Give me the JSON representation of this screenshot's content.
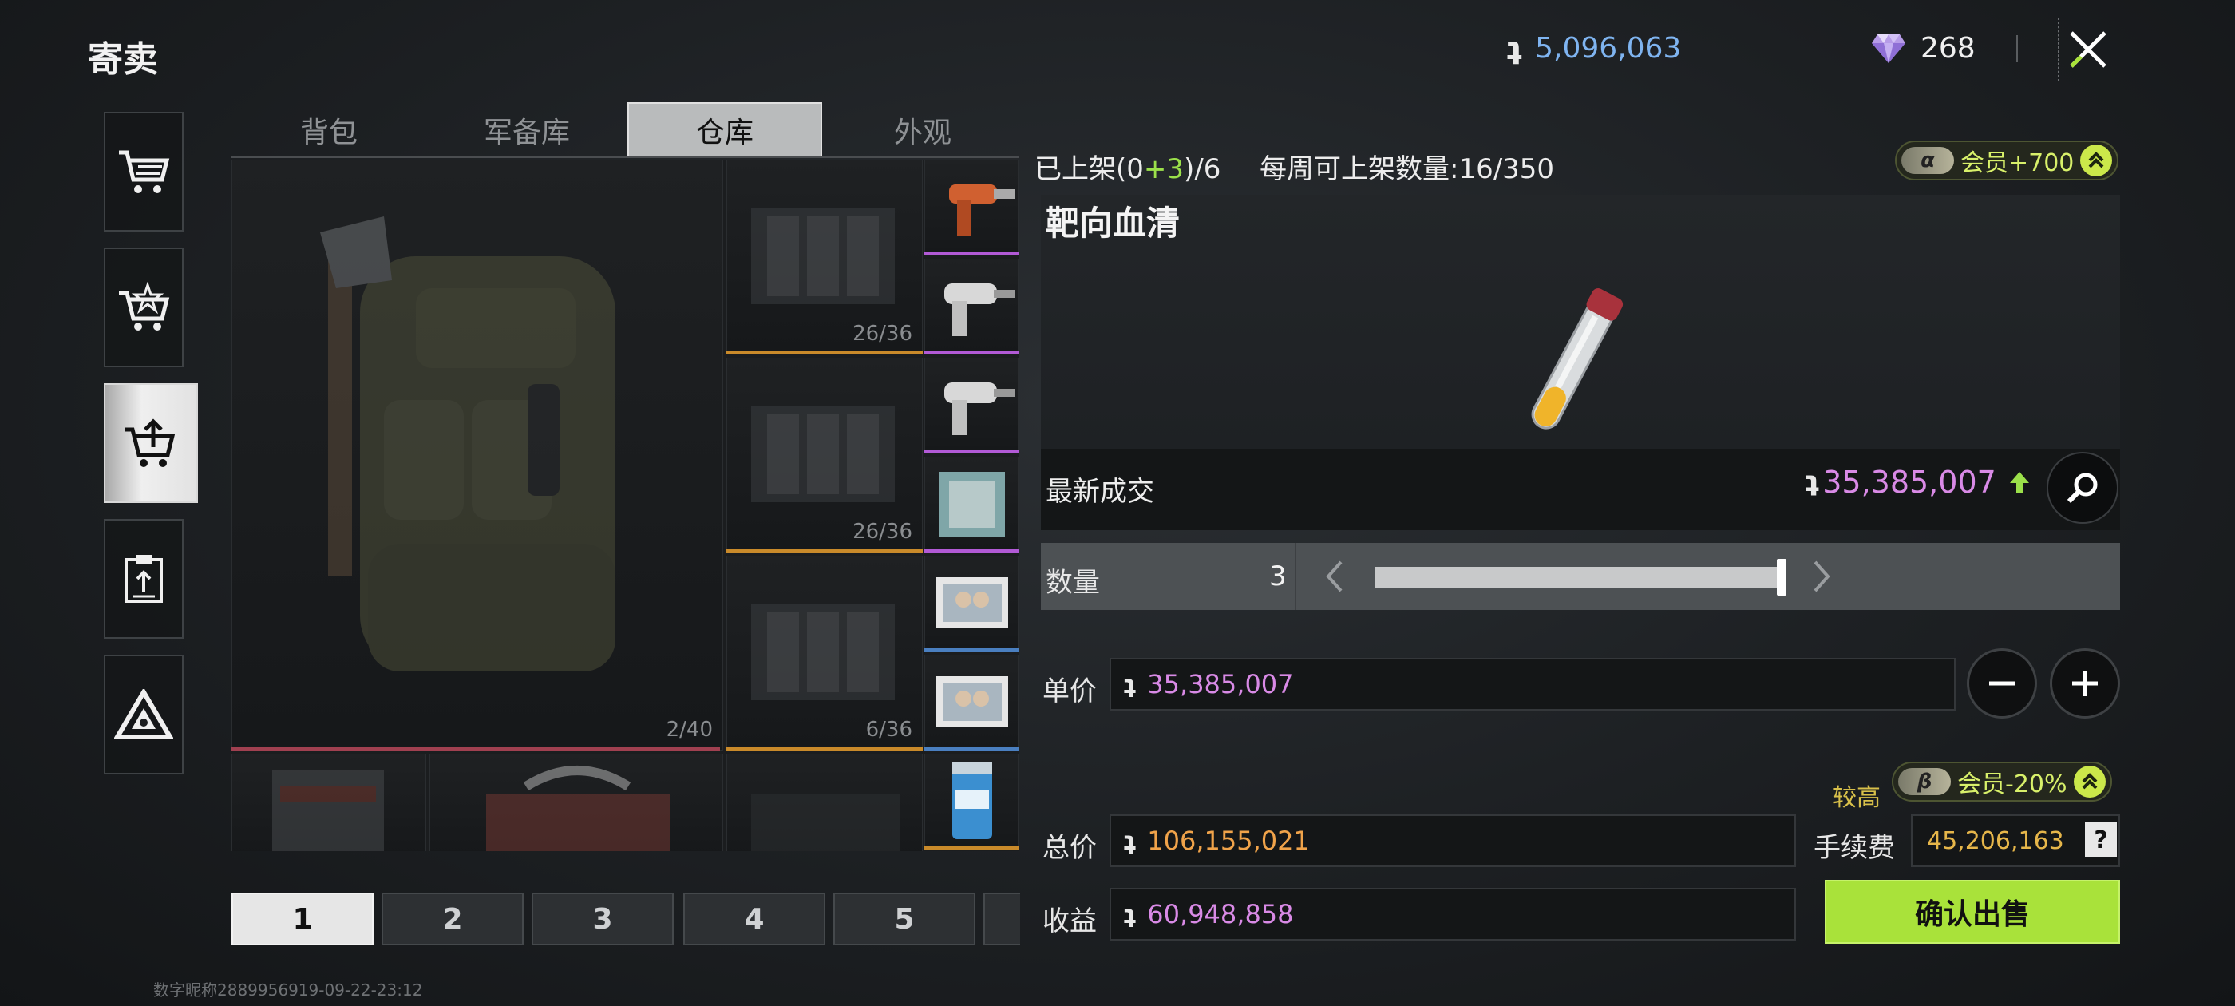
{
  "header": {
    "title": "寄卖",
    "currency_icon": "coin-icon",
    "currency_amount": "5,096,063",
    "gem_icon": "diamond-icon",
    "gem_amount": "268",
    "close_icon": "close-icon"
  },
  "sidebar": {
    "items": [
      {
        "name": "market-buy",
        "icon": "cart-icon"
      },
      {
        "name": "market-bid",
        "icon": "cart-star-icon"
      },
      {
        "name": "market-sell",
        "icon": "cart-upload-icon",
        "active": true
      },
      {
        "name": "records",
        "icon": "clipboard-icon"
      },
      {
        "name": "delta",
        "icon": "triangle-icon"
      }
    ]
  },
  "tabs": [
    "背包",
    "军备库",
    "仓库",
    "外观"
  ],
  "active_tab": 2,
  "inventory": {
    "backpack_count": "2/40",
    "rig_counts": [
      "26/36",
      "26/36",
      "6/36"
    ]
  },
  "pagination": [
    "1",
    "2",
    "3",
    "4",
    "5"
  ],
  "active_page": 0,
  "footer_tag": "数字昵称2889956919-09-22-23:12",
  "listing": {
    "listed_prefix": "已上架(0",
    "listed_plus": "+3",
    "listed_suffix": ")/6",
    "weekly": "每周可上架数量:16/350",
    "member_bonus": "会员+700",
    "member_bonus_tag": "α"
  },
  "item": {
    "name": "靶向血清",
    "latest_label": "最新成交",
    "latest_price": "35,385,007",
    "trend": "up",
    "colors": {
      "price": "#d98ae6",
      "trend": "#9be04a"
    }
  },
  "quantity": {
    "label": "数量",
    "value": "3",
    "slider_level": 1.0
  },
  "unit_price": {
    "label": "单价",
    "value": "35,385,007"
  },
  "total": {
    "label": "总价",
    "value": "106,155,021"
  },
  "fee": {
    "level": "较高",
    "member_discount": "会员-20%",
    "member_discount_tag": "β",
    "label": "手续费",
    "value": "45,206,163",
    "help": "?"
  },
  "income": {
    "label": "收益",
    "value": "60,948,858"
  },
  "confirm_label": "确认出售",
  "accent_colors": {
    "confirm": "#a9e23a",
    "currency": "#7fb4f0"
  }
}
